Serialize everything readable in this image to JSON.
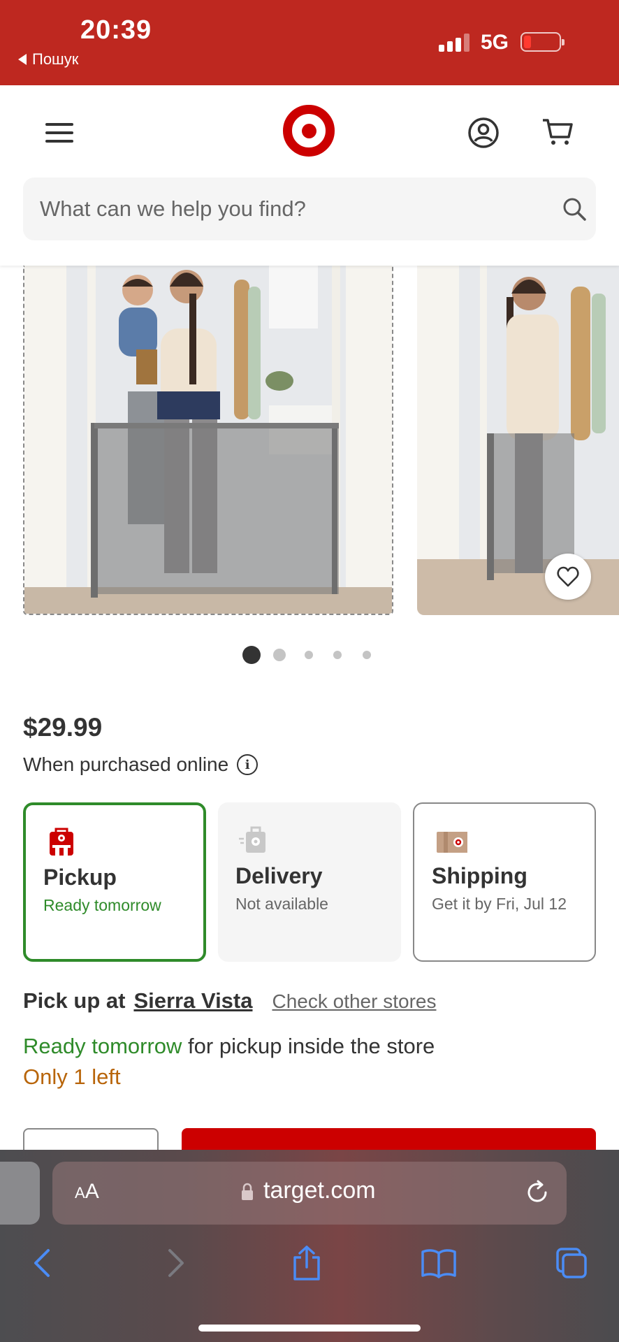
{
  "status_bar": {
    "time": "20:39",
    "back_label": "Пошук",
    "network": "5G",
    "battery_level": 0.12
  },
  "header": {
    "search_placeholder": "What can we help you find?"
  },
  "carousel": {
    "slide_count": 5,
    "active_index": 0
  },
  "product": {
    "price": "$29.99",
    "price_note": "When purchased online"
  },
  "fulfillment": [
    {
      "title": "Pickup",
      "subtitle": "Ready tomorrow",
      "selected": true,
      "icon": "pickup-store-icon"
    },
    {
      "title": "Delivery",
      "subtitle": "Not available",
      "selected": false,
      "icon": "delivery-bag-icon"
    },
    {
      "title": "Shipping",
      "subtitle": "Get it by Fri, Jul 12",
      "selected": false,
      "icon": "shipping-box-icon"
    }
  ],
  "store": {
    "pickup_label": "Pick up at",
    "store_name": "Sierra Vista",
    "check_other": "Check other stores",
    "ready_highlight": "Ready tomorrow",
    "ready_rest": " for pickup inside the store",
    "stock": "Only 1 left"
  },
  "browser": {
    "aa_label_small": "A",
    "aa_label_large": "A",
    "url": "target.com"
  },
  "colors": {
    "brand_red": "#cc0000",
    "status_red": "#be2820",
    "success_green": "#2f8b2a",
    "stock_orange": "#b8650a"
  }
}
